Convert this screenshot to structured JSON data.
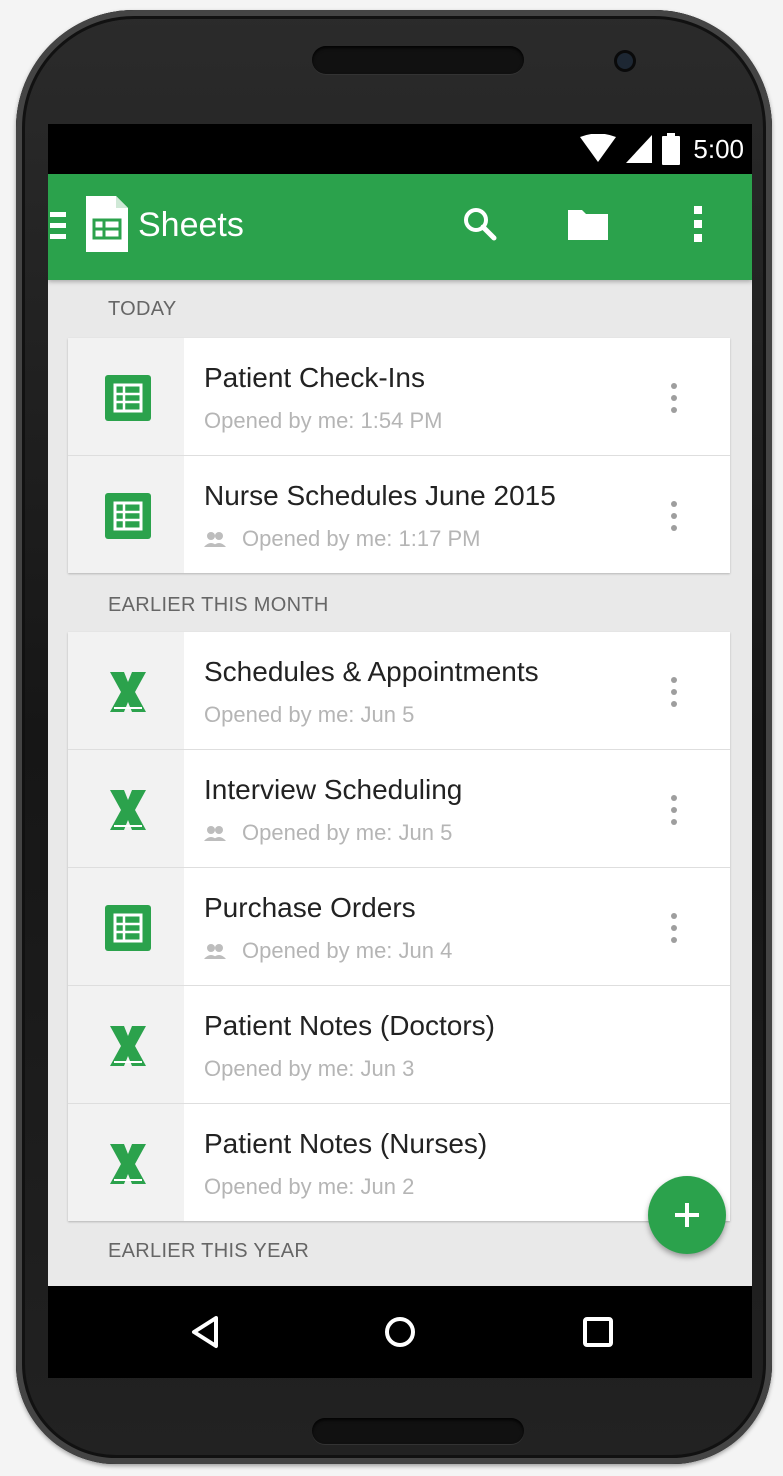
{
  "status_bar": {
    "time": "5:00",
    "icons": [
      "wifi-icon",
      "signal-icon",
      "battery-icon"
    ]
  },
  "app_bar": {
    "title": "Sheets",
    "icons": [
      "menu-icon",
      "sheets-logo-icon",
      "search-icon",
      "folder-icon",
      "more-vert-icon"
    ],
    "color": "#2ba24c"
  },
  "sections": [
    {
      "label": "TODAY",
      "files": [
        {
          "title": "Patient Check-Ins",
          "subtitle": "Opened by me: 1:54 PM",
          "type": "sheets",
          "shared": false
        },
        {
          "title": "Nurse Schedules June 2015",
          "subtitle": "Opened by me: 1:17 PM",
          "type": "sheets",
          "shared": true
        }
      ]
    },
    {
      "label": "EARLIER THIS MONTH",
      "files": [
        {
          "title": "Schedules & Appointments",
          "subtitle": "Opened by me: Jun 5",
          "type": "excel",
          "shared": false
        },
        {
          "title": "Interview Scheduling",
          "subtitle": "Opened by me: Jun 5",
          "type": "excel",
          "shared": true
        },
        {
          "title": "Purchase Orders",
          "subtitle": "Opened by me: Jun 4",
          "type": "sheets",
          "shared": true
        },
        {
          "title": "Patient Notes (Doctors)",
          "subtitle": "Opened by me: Jun 3",
          "type": "excel",
          "shared": false
        },
        {
          "title": "Patient Notes (Nurses)",
          "subtitle": "Opened by me: Jun 2",
          "type": "excel",
          "shared": false
        }
      ]
    },
    {
      "label": "EARLIER THIS YEAR",
      "files": []
    }
  ],
  "fab": {
    "icon": "plus-icon"
  },
  "nav_bar": {
    "icons": [
      "back-icon",
      "home-icon",
      "recents-icon"
    ]
  }
}
